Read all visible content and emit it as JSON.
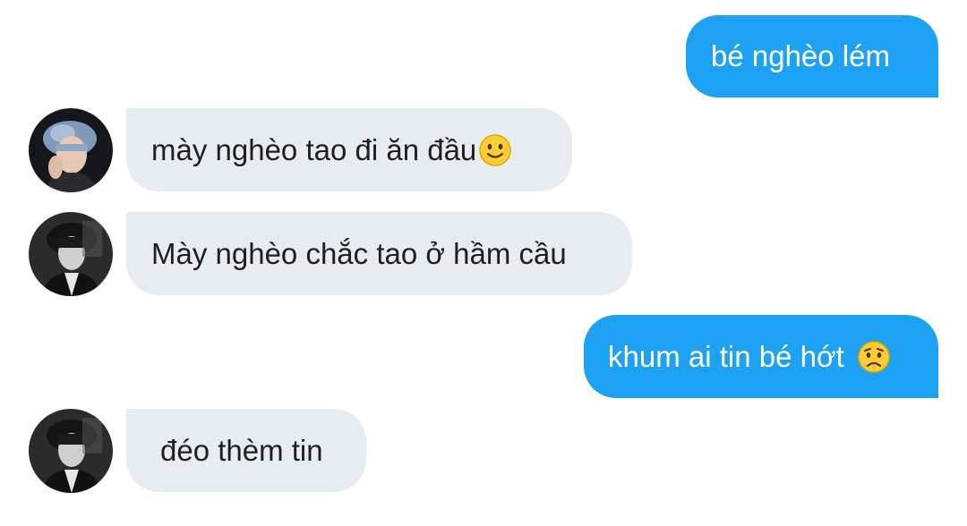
{
  "messages": [
    {
      "direction": "outgoing",
      "text": "bé nghèo lém"
    },
    {
      "direction": "incoming",
      "text": "mày nghèo tao đi ăn đầu",
      "emoji": "slightly-smiling-face-icon",
      "avatar": "avatar-blue-hair"
    },
    {
      "direction": "incoming",
      "text": "Mày nghèo chắc tao ở hầm cầu",
      "avatar": "avatar-monochrome"
    },
    {
      "direction": "outgoing",
      "text": "khum ai tin bé hớt",
      "emoji": "worried-face-icon"
    },
    {
      "direction": "incoming",
      "text": "đéo thèm tin",
      "avatar": "avatar-monochrome"
    }
  ],
  "colors": {
    "outgoing_bubble": "#1da1f2",
    "incoming_bubble": "#e6ecf0",
    "outgoing_text": "#ffffff",
    "incoming_text": "#1f1f1f",
    "background": "#ffffff"
  }
}
